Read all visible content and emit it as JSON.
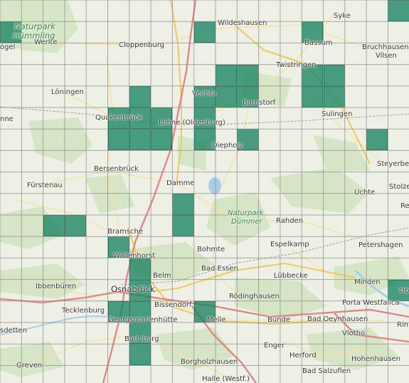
{
  "colors": {
    "background": "#eef0e6",
    "forest": "#cfe3bd",
    "highway": "#e58a8a",
    "road": "#f3d77a",
    "water": "#aacde8",
    "gridline": "#8d8d8d",
    "selected_cell": "#188462"
  },
  "places": {
    "syke": "Syke",
    "wildeshausen": "Wildeshausen",
    "vogel": "ögel",
    "werlte": "Werlte",
    "cloppenburg": "Cloppenburg",
    "bassum": "Bassum",
    "bruchhausen": "Bruchhausen-",
    "vilsen": "Vilsen",
    "twistringen": "Twistringen",
    "loningen": "Löningen",
    "vechta": "Vechta",
    "barnstorf": "Barnstorf",
    "sulingen": "Sulingen",
    "haselunne": "nne",
    "quakenbruck": "Quakenbrück",
    "lohne": "Lohne (Oldenburg)",
    "diepholz": "Diepholz",
    "steyerberg": "Steyerberg",
    "bersenbruck": "Bersenbrück",
    "furstenau": "Fürstenau",
    "damme": "Damme",
    "uchte": "Uchte",
    "stolzenau": "Stolze",
    "rehburg": "Re",
    "rahden": "Rahden",
    "bramsche": "Bramsche",
    "bohmte": "Bohmte",
    "espelkamp": "Espelkamp",
    "petershagen": "Petershagen",
    "wallenhorst": "Wallenhorst",
    "belm": "Belm",
    "bad_essen": "Bad Essen",
    "lubbecke": "Lübbecke",
    "ibbenburen": "Ibbenbüren",
    "osnabruck": "Osnabrück",
    "minden": "Minden",
    "oberlubbe": "Ob",
    "rodinghausen": "Rödinghausen",
    "tecklenburg": "Tecklenburg",
    "bissendorf": "Bissendorf",
    "porta": "Porta Westfalica",
    "georgsmarienhutte": "Georgsmarienhütte",
    "melle": "Melle",
    "bunde": "Bünde",
    "bad_oeynhausen": "Bad Oeynhausen",
    "rinteln": "Rint",
    "hoerstel": "sdetten",
    "vlotho": "Vlotho",
    "bad_iburg": "Bad Iburg",
    "enger": "Enger",
    "herford": "Herford",
    "hohenhausen": "Hohenhausen",
    "greven": "Greven",
    "borgholzhausen": "Borgholzhausen",
    "bad_salzuflen": "Bad Salzuflen",
    "halle": "Halle (Westf.)"
  },
  "parks": {
    "hummling_line1": "Naturpark",
    "hummling_line2": "Hümmling",
    "dummer_line1": "Naturpark",
    "dummer_line2": "Dümmer"
  },
  "selected_cells": [
    [
      18,
      0
    ],
    [
      0,
      1
    ],
    [
      9,
      1
    ],
    [
      14,
      1
    ],
    [
      10,
      3
    ],
    [
      11,
      3
    ],
    [
      14,
      3
    ],
    [
      15,
      3
    ],
    [
      6,
      4
    ],
    [
      9,
      4
    ],
    [
      10,
      4
    ],
    [
      11,
      4
    ],
    [
      14,
      4
    ],
    [
      15,
      4
    ],
    [
      5,
      5
    ],
    [
      6,
      5
    ],
    [
      7,
      5
    ],
    [
      9,
      5
    ],
    [
      5,
      6
    ],
    [
      6,
      6
    ],
    [
      7,
      6
    ],
    [
      9,
      6
    ],
    [
      11,
      6
    ],
    [
      17,
      6
    ],
    [
      8,
      9
    ],
    [
      2,
      10
    ],
    [
      3,
      10
    ],
    [
      8,
      10
    ],
    [
      5,
      11
    ],
    [
      6,
      12
    ],
    [
      6,
      13
    ],
    [
      18,
      13
    ],
    [
      5,
      14
    ],
    [
      6,
      14
    ],
    [
      9,
      14
    ],
    [
      6,
      15
    ],
    [
      6,
      16
    ]
  ]
}
